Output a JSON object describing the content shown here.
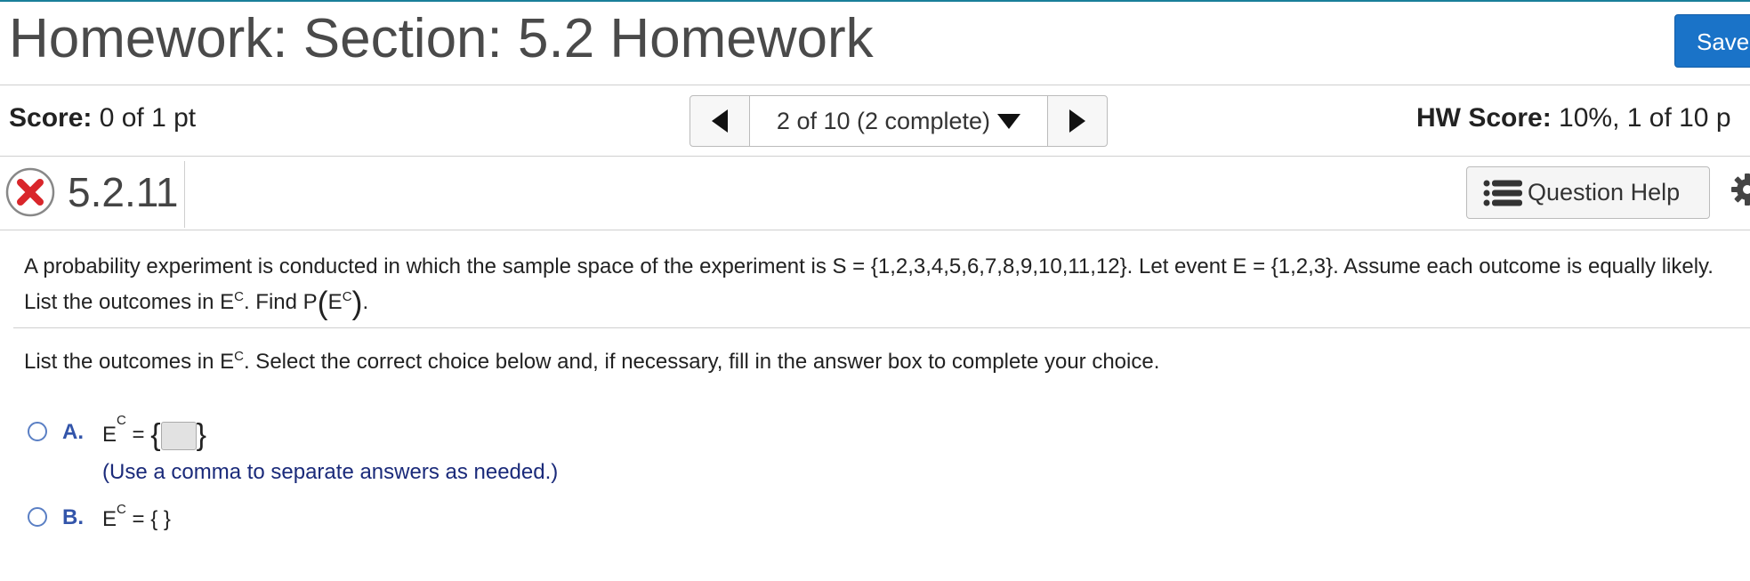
{
  "header": {
    "title": "Homework: Section: 5.2 Homework",
    "save_label": "Save"
  },
  "score_bar": {
    "score_label": "Score:",
    "score_value": "0 of 1 pt",
    "nav_status": "2 of 10 (2 complete)",
    "hw_score_label": "HW Score:",
    "hw_score_value": "10%, 1 of 10 p"
  },
  "question_bar": {
    "number": "5.2.11",
    "status": "incorrect",
    "help_label": "Question Help"
  },
  "problem": {
    "text_part1": "A probability experiment is conducted in which the sample space of the experiment is S = {1,2,3,4,5,6,7,8,9,10,11,12}. Let event E = {1,2,3}. Assume each outcome is equally likely. List the outcomes in E",
    "sup_c": "C",
    "text_part2": ". Find P",
    "p_inner": "E",
    "period": "."
  },
  "instruction": {
    "text1": "List the outcomes in E",
    "sup_c": "C",
    "text2": ". Select the correct choice below and, if necessary, fill in the answer box to complete your choice."
  },
  "choices": [
    {
      "letter": "A.",
      "var": "E",
      "sup": "C",
      "eq": " = ",
      "open": "{",
      "close": "}",
      "hint": "(Use a comma to separate answers as needed.)"
    },
    {
      "letter": "B.",
      "var": "E",
      "sup": "C",
      "eq": " = { }"
    }
  ],
  "colors": {
    "accent": "#1a73c8",
    "error": "#d9262b",
    "choice_letter": "#3355aa",
    "hint": "#1a2a7a"
  }
}
